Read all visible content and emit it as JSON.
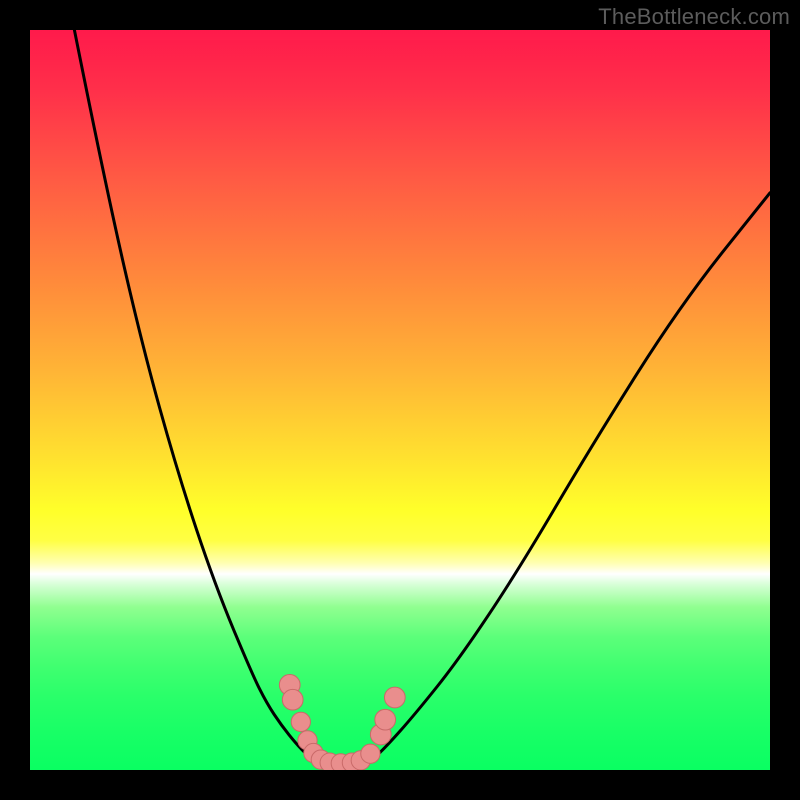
{
  "attribution": "TheBottleneck.com",
  "colors": {
    "frame": "#000000",
    "curve_stroke": "#000000",
    "marker_fill": "#e98e8d",
    "marker_stroke": "#c96a69",
    "gradient_stops": [
      {
        "pct": 0,
        "hex": "#ff1a4b"
      },
      {
        "pct": 20,
        "hex": "#ff5a44"
      },
      {
        "pct": 46,
        "hex": "#ffb436"
      },
      {
        "pct": 65,
        "hex": "#ffff2a"
      },
      {
        "pct": 73.5,
        "hex": "#ffffff"
      },
      {
        "pct": 82,
        "hex": "#5cff7a"
      },
      {
        "pct": 100,
        "hex": "#0aff62"
      }
    ]
  },
  "chart_data": {
    "type": "line",
    "title": "",
    "xlabel": "",
    "ylabel": "",
    "xlim": [
      0,
      100
    ],
    "ylim": [
      0,
      100
    ],
    "grid": false,
    "series": [
      {
        "name": "left-curve",
        "x": [
          6,
          10,
          15,
          20,
          25,
          30,
          32,
          34,
          36,
          37.5,
          38.5
        ],
        "y": [
          100,
          80,
          58,
          40,
          25,
          13,
          9,
          6,
          3.5,
          2.0,
          1.2
        ]
      },
      {
        "name": "valley-floor",
        "x": [
          38.5,
          40,
          42,
          44,
          46
        ],
        "y": [
          1.2,
          0.8,
          0.7,
          0.8,
          1.2
        ]
      },
      {
        "name": "right-curve",
        "x": [
          46,
          48,
          52,
          58,
          66,
          76,
          88,
          100
        ],
        "y": [
          1.2,
          3.0,
          7.5,
          15,
          27,
          44,
          63,
          78
        ]
      }
    ],
    "markers": [
      {
        "x": 35.1,
        "y": 11.5,
        "r": 1.4
      },
      {
        "x": 35.5,
        "y": 9.5,
        "r": 1.4
      },
      {
        "x": 36.6,
        "y": 6.5,
        "r": 1.3
      },
      {
        "x": 37.5,
        "y": 4.0,
        "r": 1.3
      },
      {
        "x": 38.3,
        "y": 2.3,
        "r": 1.3
      },
      {
        "x": 39.3,
        "y": 1.4,
        "r": 1.3
      },
      {
        "x": 40.5,
        "y": 1.0,
        "r": 1.3
      },
      {
        "x": 42.0,
        "y": 0.9,
        "r": 1.3
      },
      {
        "x": 43.5,
        "y": 1.0,
        "r": 1.3
      },
      {
        "x": 44.7,
        "y": 1.3,
        "r": 1.3
      },
      {
        "x": 46.0,
        "y": 2.2,
        "r": 1.3
      },
      {
        "x": 47.4,
        "y": 4.8,
        "r": 1.4
      },
      {
        "x": 48.0,
        "y": 6.8,
        "r": 1.4
      },
      {
        "x": 49.3,
        "y": 9.8,
        "r": 1.4
      }
    ]
  }
}
